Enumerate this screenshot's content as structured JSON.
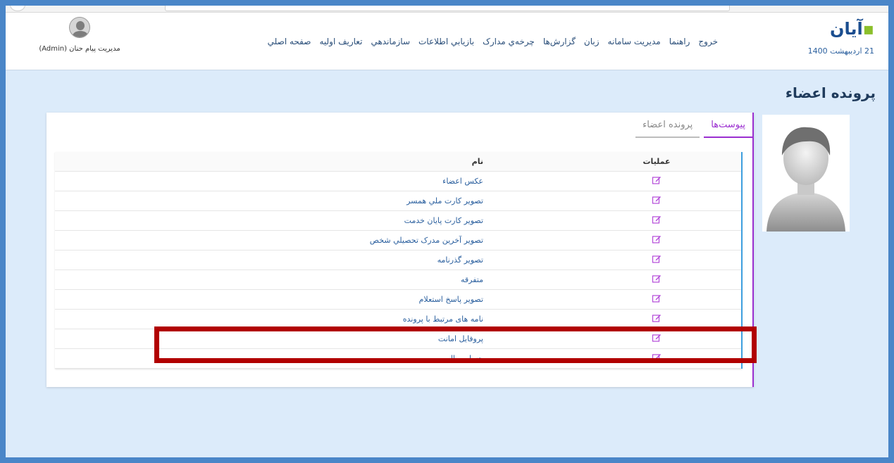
{
  "header": {
    "logo_text": "آیان",
    "date": "21 اردیبهشت 1400",
    "nav": [
      "صفحه اصلي",
      "تعاريف اوليه",
      "سازماندهي",
      "بازيابي اطلاعات",
      "چرخه‌ي مدارک",
      "گزارش‌ها",
      "زبان",
      "مديريت سامانه",
      "راهنما",
      "خروج"
    ],
    "user_name": "مدیریت پیام حنان (Admin)"
  },
  "page": {
    "title": "پرونده اعضاء"
  },
  "tabs": [
    {
      "label": "پرونده اعضاء",
      "active": false
    },
    {
      "label": "پیوست‌ها",
      "active": true
    }
  ],
  "table": {
    "headers": {
      "name": "نام",
      "ops": "عملیات"
    },
    "rows": [
      "عکس اعضاء",
      "تصویر کارت ملي همسر",
      "تصویر کارت پایان خدمت",
      "تصویر آخرین مدرک تحصیلي شخص",
      "تصویر گذرنامه",
      "متفرقه",
      "تصویر پاسخ استعلام",
      "نامه های مرتبط با پرونده",
      "پروفایل امانت",
      "حساب مالي"
    ]
  },
  "colors": {
    "accent_purple": "#9b2fd0",
    "accent_blue": "#3fa0e0",
    "highlight_red": "#b10000",
    "page_bg": "#dcebfa"
  },
  "icons": {
    "edit": "edit-pencil-icon"
  }
}
